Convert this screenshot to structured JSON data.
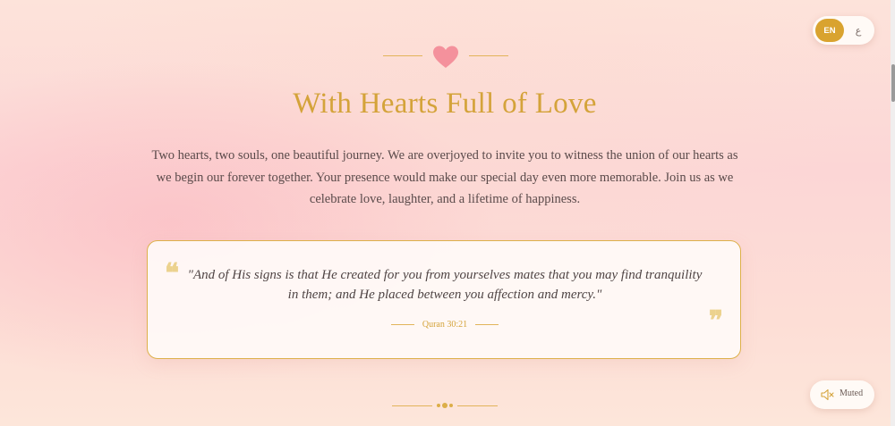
{
  "language_toggle": {
    "en_label": "EN",
    "ar_label": "ع",
    "active": "EN"
  },
  "ornament": {
    "icon": "heart-icon"
  },
  "title": "With Hearts Full of Love",
  "intro": "Two hearts, two souls, one beautiful journey. We are overjoyed to invite you to witness the union of our hearts as we begin our forever together. Your presence would make our special day even more memorable. Join us as we celebrate love, laughter, and a lifetime of happiness.",
  "quote": {
    "open_mark": "❝",
    "close_mark": "❞",
    "text": "\"And of His signs is that He created for you from yourselves mates that you may find tranquility in them; and He placed between you affection and mercy.\"",
    "citation": "Quran 30:21"
  },
  "audio": {
    "status_label": "Muted",
    "icon": "speaker-muted-icon"
  },
  "colors": {
    "gold": "#d4a33a",
    "heart": "#f28f9b",
    "text": "#5a4a4a",
    "background": "#fcd9d6"
  }
}
